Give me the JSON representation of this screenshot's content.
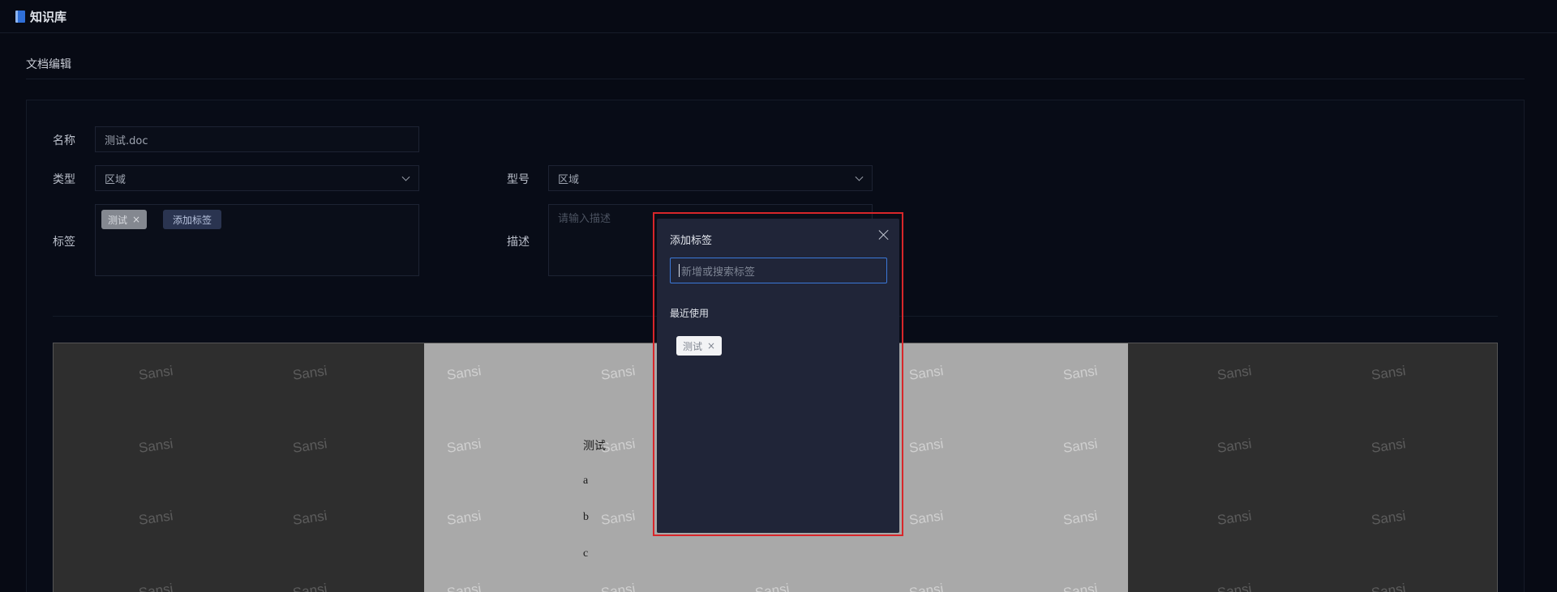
{
  "app": {
    "title": "知识库"
  },
  "section": {
    "title": "文档编辑"
  },
  "form": {
    "name_label": "名称",
    "name_value": "测试.doc",
    "type_label": "类型",
    "type_value": "区域",
    "model_label": "型号",
    "model_value": "区域",
    "tags_label": "标签",
    "tags": [
      {
        "label": "测试",
        "remove": "×"
      }
    ],
    "add_tag_label": "添加标签",
    "desc_label": "描述",
    "desc_placeholder": "请输入描述"
  },
  "preview": {
    "watermark": "Sansi",
    "lines": [
      "测试",
      "a",
      "b",
      "c"
    ]
  },
  "popover": {
    "title": "添加标签",
    "input_placeholder": "新增或搜索标签",
    "recent_label": "最近使用",
    "recent_tags": [
      {
        "label": "测试",
        "remove": "×"
      }
    ]
  },
  "icons": {
    "app": "book-icon",
    "dropdown": "chevron-down-icon",
    "close": "close-icon",
    "tag_remove": "close-icon"
  },
  "colors": {
    "background": "#070a14",
    "popover": "#202538",
    "highlight": "#d8262a",
    "accent": "#3b78d8"
  }
}
